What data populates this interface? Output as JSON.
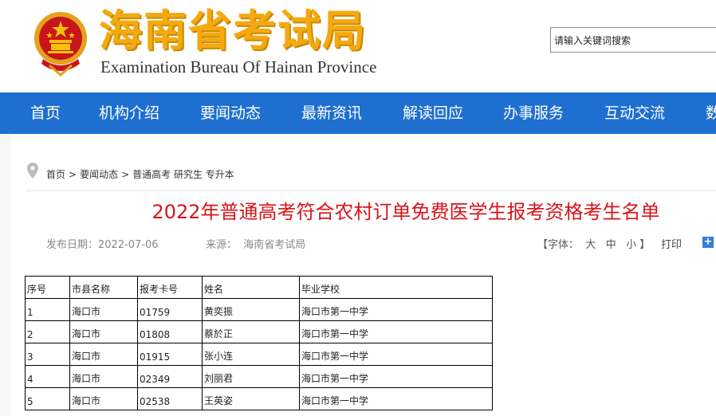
{
  "header": {
    "title_cn": "海南省考试局",
    "title_en": "Examination Bureau Of Hainan Province",
    "search_value": "请输入关键词搜索"
  },
  "nav": {
    "items": [
      {
        "label": "首页"
      },
      {
        "label": "机构介绍"
      },
      {
        "label": "要闻动态"
      },
      {
        "label": "最新资讯"
      },
      {
        "label": "解读回应"
      },
      {
        "label": "办事服务"
      },
      {
        "label": "互动交流"
      },
      {
        "label": "数"
      }
    ]
  },
  "breadcrumb": {
    "home": "首页",
    "sep": ">",
    "section": "要闻动态",
    "category": "普通高考 研究生 专升本"
  },
  "article": {
    "title": "2022年普通高考符合农村订单免费医学生报考资格考生名单",
    "publish_label": "发布日期：",
    "publish_date": "2022-07-06",
    "source_label": "来源：",
    "source_value": "海南省考试局",
    "font_label": "【字体：",
    "font_large": "大",
    "font_medium": "中",
    "font_small": "小",
    "font_end": "】",
    "print_label": "打印"
  },
  "table": {
    "headers": [
      "序号",
      "市县名称",
      "报考卡号",
      "姓名",
      "毕业学校"
    ],
    "rows": [
      [
        "1",
        "海口市",
        "01759",
        "黄奕振",
        "海口市第一中学"
      ],
      [
        "2",
        "海口市",
        "01808",
        "蔡於正",
        "海口市第一中学"
      ],
      [
        "3",
        "海口市",
        "01915",
        "张小连",
        "海口市第一中学"
      ],
      [
        "4",
        "海口市",
        "02349",
        "刘丽君",
        "海口市第一中学"
      ],
      [
        "5",
        "海口市",
        "02538",
        "王英姿",
        "海口市第一中学"
      ]
    ]
  },
  "colors": {
    "nav_bg": "#1f6fd0",
    "title_red": "#d7141a",
    "brand_gold": "#f5a90f"
  }
}
